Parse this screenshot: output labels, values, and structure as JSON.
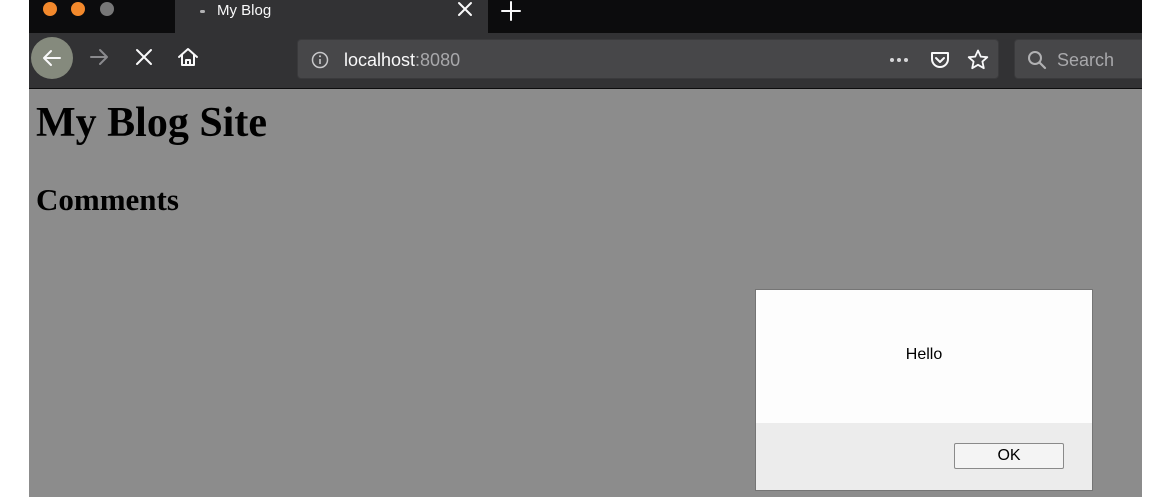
{
  "browser": {
    "tab_title": "My Blog",
    "url_host": "localhost",
    "url_port": ":8080",
    "search_placeholder": "Search"
  },
  "page": {
    "heading": "My Blog Site",
    "subheading": "Comments"
  },
  "dialog": {
    "message": "Hello",
    "ok_label": "OK"
  },
  "colors": {
    "chrome_dark": "#0c0c0d",
    "toolbar": "#323234",
    "page_background": "#8c8c8c",
    "traffic_light": "#f3892c"
  }
}
